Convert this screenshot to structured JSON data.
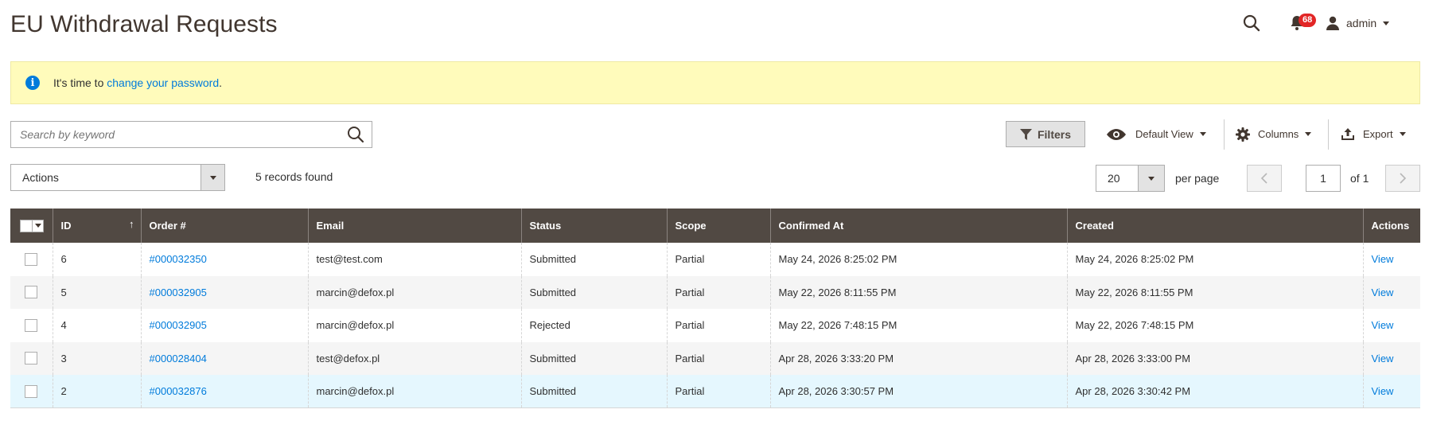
{
  "page": {
    "title": "EU Withdrawal Requests"
  },
  "header": {
    "notifications_count": "68",
    "user": "admin"
  },
  "notice": {
    "text_before": "It's time to ",
    "link": "change your password",
    "text_after": "."
  },
  "toolbar": {
    "search_placeholder": "Search by keyword",
    "filters": "Filters",
    "default_view": "Default View",
    "columns": "Columns",
    "export": "Export",
    "actions": "Actions",
    "records_found": "5 records found",
    "per_page_value": "20",
    "per_page_label": "per page",
    "current_page": "1",
    "of_pages": "of 1"
  },
  "grid": {
    "columns": [
      "ID",
      "Order #",
      "Email",
      "Status",
      "Scope",
      "Confirmed At",
      "Created",
      "Actions"
    ],
    "rows": [
      {
        "id": "6",
        "order": "#000032350",
        "email": "test@test.com",
        "status": "Submitted",
        "scope": "Partial",
        "confirmed": "May 24, 2026 8:25:02 PM",
        "created": "May 24, 2026 8:25:02 PM",
        "action": "View"
      },
      {
        "id": "5",
        "order": "#000032905",
        "email": "marcin@defox.pl",
        "status": "Submitted",
        "scope": "Partial",
        "confirmed": "May 22, 2026 8:11:55 PM",
        "created": "May 22, 2026 8:11:55 PM",
        "action": "View"
      },
      {
        "id": "4",
        "order": "#000032905",
        "email": "marcin@defox.pl",
        "status": "Rejected",
        "scope": "Partial",
        "confirmed": "May 22, 2026 7:48:15 PM",
        "created": "May 22, 2026 7:48:15 PM",
        "action": "View"
      },
      {
        "id": "3",
        "order": "#000028404",
        "email": "test@defox.pl",
        "status": "Submitted",
        "scope": "Partial",
        "confirmed": "Apr 28, 2026 3:33:20 PM",
        "created": "Apr 28, 2026 3:33:00 PM",
        "action": "View"
      },
      {
        "id": "2",
        "order": "#000032876",
        "email": "marcin@defox.pl",
        "status": "Submitted",
        "scope": "Partial",
        "confirmed": "Apr 28, 2026 3:30:57 PM",
        "created": "Apr 28, 2026 3:30:42 PM",
        "action": "View"
      }
    ]
  },
  "colors": {
    "header_bg": "#514943",
    "link": "#007bdb",
    "notice_bg": "#fffbbb",
    "badge": "#e22626",
    "row_highlight": "#e5f7fe"
  },
  "icons": [
    "search-icon",
    "bell-icon",
    "user-icon",
    "info-icon",
    "filter-icon",
    "eye-icon",
    "gear-icon",
    "export-icon",
    "chevron-left-icon",
    "chevron-right-icon",
    "sort-asc-icon"
  ]
}
